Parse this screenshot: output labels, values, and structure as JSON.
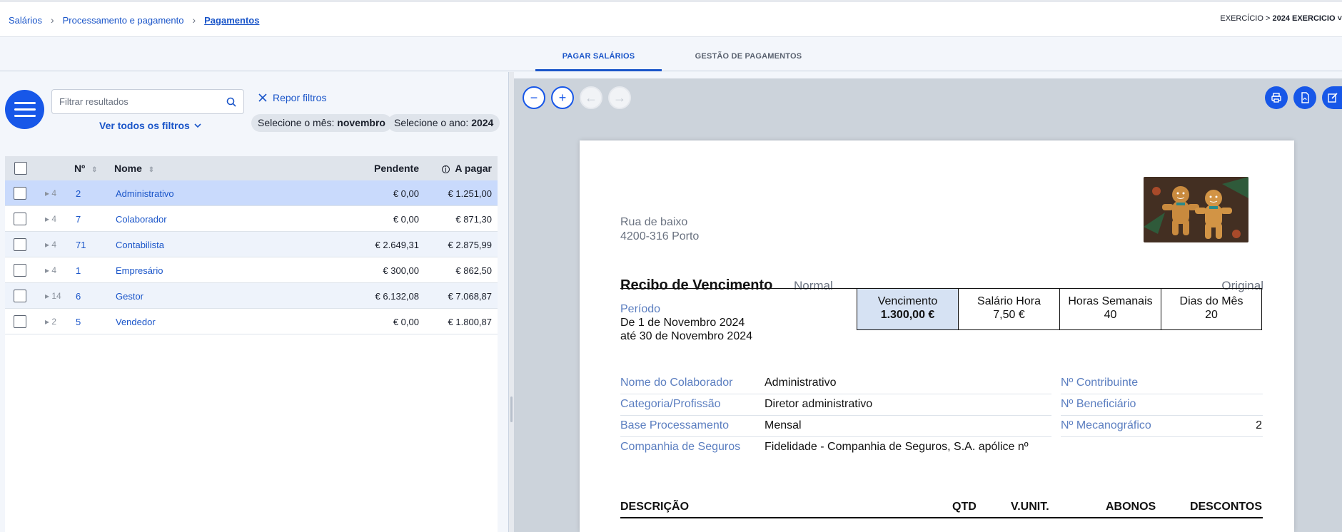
{
  "breadcrumb": {
    "items": [
      "Salários",
      "Processamento e pagamento"
    ],
    "current": "Pagamentos"
  },
  "exercise": {
    "prefix": "EXERCÍCIO >",
    "value": "2024 EXERCICIO ˅"
  },
  "tabs": [
    {
      "label": "PAGAR SALÁRIOS",
      "active": true
    },
    {
      "label": "GESTÃO DE PAGAMENTOS",
      "active": false
    }
  ],
  "filters": {
    "search_placeholder": "Filtrar resultados",
    "reset_label": "Repor filtros",
    "all_filters_label": "Ver todos os filtros",
    "month_label": "Selecione o mês:",
    "month_value": "novembro",
    "year_label": "Selecione o ano:",
    "year_value": "2024"
  },
  "table": {
    "columns": {
      "num": "Nº",
      "name": "Nome",
      "pending": "Pendente",
      "to_pay": "A pagar"
    },
    "rows": [
      {
        "count": "4",
        "num": "2",
        "name": "Administrativo",
        "pending": "€ 0,00",
        "to_pay": "€ 1.251,00",
        "selected": true
      },
      {
        "count": "4",
        "num": "7",
        "name": "Colaborador",
        "pending": "€ 0,00",
        "to_pay": "€ 871,30"
      },
      {
        "count": "4",
        "num": "71",
        "name": "Contabilista",
        "pending": "€ 2.649,31",
        "to_pay": "€ 2.875,99"
      },
      {
        "count": "4",
        "num": "1",
        "name": "Empresário",
        "pending": "€ 300,00",
        "to_pay": "€ 862,50"
      },
      {
        "count": "14",
        "num": "6",
        "name": "Gestor",
        "pending": "€ 6.132,08",
        "to_pay": "€ 7.068,87"
      },
      {
        "count": "2",
        "num": "5",
        "name": "Vendedor",
        "pending": "€ 0,00",
        "to_pay": "€ 1.800,87"
      }
    ]
  },
  "viewer": {
    "zoom_out": "−",
    "zoom_in": "+",
    "prev": "←",
    "next": "→",
    "icons": [
      "print-icon",
      "pdf-icon",
      "edit-icon"
    ]
  },
  "document": {
    "address_line1": "Rua de baixo",
    "address_line2": "4200-316 Porto",
    "title": "Recibo de Vencimento",
    "type": "Normal",
    "copy": "Original",
    "period_label": "Período",
    "period_from": "De 1 de Novembro 2024",
    "period_to": "até 30 de Novembro 2024",
    "salary_box": [
      {
        "label": "Vencimento",
        "value": "1.300,00 €"
      },
      {
        "label": "Salário Hora",
        "value": "7,50 €"
      },
      {
        "label": "Horas Semanais",
        "value": "40"
      },
      {
        "label": "Dias do Mês",
        "value": "20"
      }
    ],
    "info": [
      {
        "label": "Nome do Colaborador",
        "value": "Administrativo",
        "label2": "Nº Contribuinte",
        "value2": ""
      },
      {
        "label": "Categoria/Profissão",
        "value": "Diretor administrativo",
        "label2": "Nº Beneficiário",
        "value2": ""
      },
      {
        "label": "Base Processamento",
        "value": "Mensal",
        "label2": "Nº Mecanográfico",
        "value2": "2"
      },
      {
        "label": "Companhia de Seguros",
        "value": "Fidelidade - Companhia de Seguros, S.A. apólice nº",
        "label2": "",
        "value2": ""
      }
    ],
    "columns": {
      "desc": "DESCRIÇÃO",
      "qty": "QTD",
      "unit": "V.UNIT.",
      "credits": "ABONOS",
      "debits": "DESCONTOS"
    }
  },
  "colors": {
    "accent": "#1757e8",
    "link": "#1a55c9",
    "selected_row": "#c9dafc",
    "viewer_bg": "#ccd3db"
  }
}
